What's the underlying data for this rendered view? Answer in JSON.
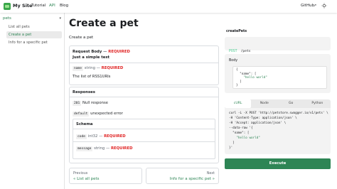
{
  "navbar": {
    "brand": "My Site",
    "links": [
      "Tutorial",
      "API",
      "Blog"
    ],
    "github": "GitHub",
    "ext_glyph": "↗",
    "icons": [
      "site-logo-icon",
      "external-link-icon",
      "theme-toggle-icon"
    ]
  },
  "sidebar": {
    "category": "pets",
    "category_chevron": "▾",
    "items": [
      "List all pets",
      "Create a pet",
      "Info for a specific pet"
    ]
  },
  "main": {
    "title": "Create a pet",
    "description": "Create a pet",
    "request_body": {
      "label": "Request Body",
      "dash": "—",
      "required": "REQUIRED",
      "desc": "Just a simple test",
      "field_name": "name",
      "field_type": "string",
      "field_required": "REQUIRED",
      "field_desc": "The list of RSS1URIs"
    },
    "responses": {
      "header": "Responses",
      "r201_code": "201",
      "r201_text": "Null response",
      "default_code": "default",
      "default_text": "unexpected error",
      "schema_label": "Schema",
      "code_field": "code",
      "code_type": "int32",
      "message_field": "message",
      "message_type": "string",
      "required": "REQUIRED"
    }
  },
  "pager": {
    "prev_label": "Previous",
    "prev_name": "« List all pets",
    "next_label": "Next",
    "next_name": "Info for a specific pet »"
  },
  "right_panel": {
    "operation_id": "createPets",
    "method": "POST",
    "path": "/pets",
    "body_label": "Body",
    "json_lines": [
      "{",
      "  \"name\": [",
      "    \"hello world\"",
      "  ]",
      "}"
    ],
    "tabs": [
      "cURL",
      "Node",
      "Go",
      "Python"
    ],
    "active_tab": "cURL",
    "curl_lines": [
      "curl -L -X POST 'http://petstore.swagger.io/v1/pets' \\",
      "-H 'Content-Type: application/json' \\",
      "-H 'Accept: application/json' \\",
      "--data-raw '{",
      "  \"name\": [",
      "    \"hello world\"",
      "  ]",
      "}'"
    ],
    "execute": "Execute"
  },
  "colors": {
    "accent": "#2e8555",
    "required": "#e02424",
    "post_method": "#49cc90"
  }
}
